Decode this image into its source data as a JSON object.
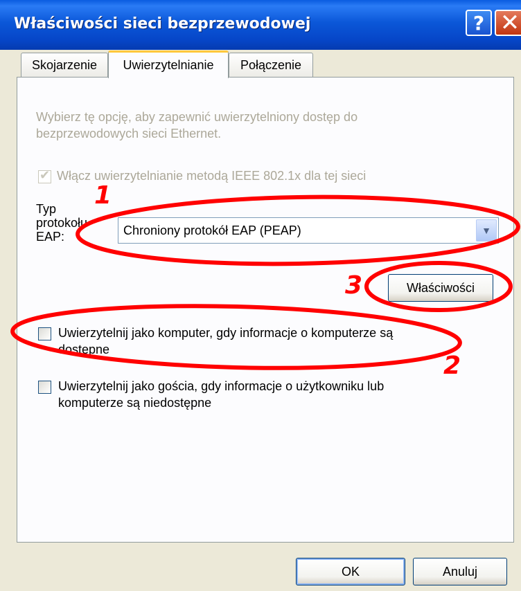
{
  "window": {
    "title": "Właściwości sieci bezprzewodowej",
    "help_glyph": "?",
    "close_glyph": "✕"
  },
  "tabs": [
    {
      "label": "Skojarzenie",
      "active": false
    },
    {
      "label": "Uwierzytelnianie",
      "active": true
    },
    {
      "label": "Połączenie",
      "active": false
    }
  ],
  "auth": {
    "description_line1": "Wybierz tę opcję, aby zapewnić uwierzytelniony dostęp do",
    "description_line2": "bezprzewodowych sieci Ethernet.",
    "enable_8021x": {
      "label": "Włącz uwierzytelnianie metodą IEEE 802.1x dla tej sieci",
      "checked": true,
      "disabled": true
    },
    "eap_type_label_line1": "Typ",
    "eap_type_label_line2": "protokołu",
    "eap_type_label_line3": "EAP:",
    "eap_type_value": "Chroniony protokół EAP (PEAP)",
    "properties_button": "Właściwości",
    "auth_as_computer": {
      "line1": "Uwierzytelnij jako komputer, gdy informacje o komputerze są",
      "line2": "dostępne",
      "checked": false
    },
    "auth_as_guest": {
      "line1": "Uwierzytelnij jako gościa, gdy informacje o użytkowniku lub",
      "line2": "komputerze są niedostępne",
      "checked": false
    }
  },
  "footer": {
    "ok": "OK",
    "cancel": "Anuluj"
  },
  "annotations": {
    "n1": "1",
    "n2": "2",
    "n3": "3",
    "color": "#FF0000"
  }
}
